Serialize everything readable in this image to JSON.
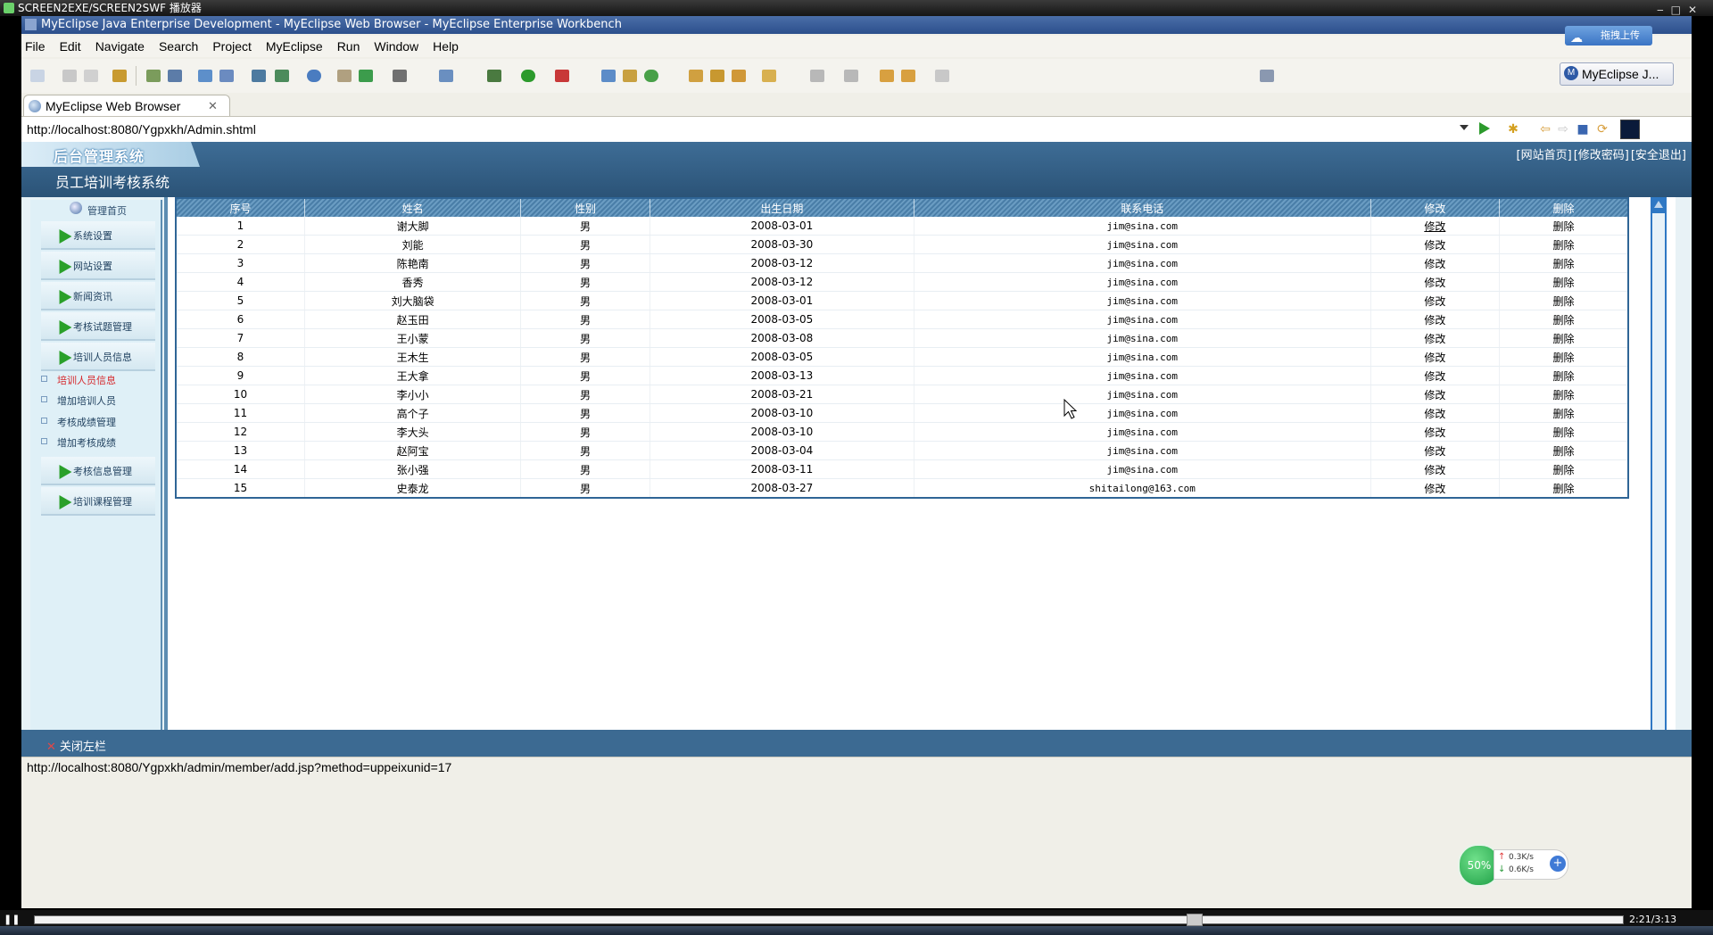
{
  "player": {
    "title": "SCREEN2EXE/SCREEN2SWF 播放器",
    "time": "2:21/3:13"
  },
  "workbench": {
    "title": "MyEclipse Java Enterprise Development - MyEclipse Web Browser - MyEclipse Enterprise Workbench",
    "menu": [
      "File",
      "Edit",
      "Navigate",
      "Search",
      "Project",
      "MyEclipse",
      "Run",
      "Window",
      "Help"
    ],
    "upload_button": "拖拽上传",
    "perspective": "MyEclipse J...",
    "tab_label": "MyEclipse Web Browser",
    "url": "http://localhost:8080/Ygpxkh/Admin.shtml",
    "status_url": "http://localhost:8080/Ygpxkh/admin/member/add.jsp?method=uppeixunid=17"
  },
  "page": {
    "logo": "后台管理系统",
    "system_title": "员工培训考核系统",
    "header_links": [
      "[网站首页]",
      "[修改密码]",
      "[安全退出]"
    ],
    "admin_home": "管理首页",
    "menu_blocks": [
      {
        "label": "系统设置"
      },
      {
        "label": "网站设置"
      },
      {
        "label": "新闻资讯"
      },
      {
        "label": "考核试题管理"
      },
      {
        "label": "培训人员信息"
      },
      {
        "label": "考核信息管理"
      },
      {
        "label": "培训课程管理"
      }
    ],
    "sub_items": [
      {
        "label": "培训人员信息",
        "active": true
      },
      {
        "label": "增加培训人员",
        "active": false
      },
      {
        "label": "考核成绩管理",
        "active": false
      },
      {
        "label": "增加考核成绩",
        "active": false
      }
    ],
    "close_left": "关闭左栏"
  },
  "table": {
    "headers": [
      "序号",
      "姓名",
      "性别",
      "出生日期",
      "联系电话",
      "修改",
      "删除"
    ],
    "rows": [
      [
        "1",
        "谢大脚",
        "男",
        "2008-03-01",
        "jim@sina.com",
        "修改",
        "删除"
      ],
      [
        "2",
        "刘能",
        "男",
        "2008-03-30",
        "jim@sina.com",
        "修改",
        "删除"
      ],
      [
        "3",
        "陈艳南",
        "男",
        "2008-03-12",
        "jim@sina.com",
        "修改",
        "删除"
      ],
      [
        "4",
        "香秀",
        "男",
        "2008-03-12",
        "jim@sina.com",
        "修改",
        "删除"
      ],
      [
        "5",
        "刘大脑袋",
        "男",
        "2008-03-01",
        "jim@sina.com",
        "修改",
        "删除"
      ],
      [
        "6",
        "赵玉田",
        "男",
        "2008-03-05",
        "jim@sina.com",
        "修改",
        "删除"
      ],
      [
        "7",
        "王小蒙",
        "男",
        "2008-03-08",
        "jim@sina.com",
        "修改",
        "删除"
      ],
      [
        "8",
        "王木生",
        "男",
        "2008-03-05",
        "jim@sina.com",
        "修改",
        "删除"
      ],
      [
        "9",
        "王大拿",
        "男",
        "2008-03-13",
        "jim@sina.com",
        "修改",
        "删除"
      ],
      [
        "10",
        "李小小",
        "男",
        "2008-03-21",
        "jim@sina.com",
        "修改",
        "删除"
      ],
      [
        "11",
        "高个子",
        "男",
        "2008-03-10",
        "jim@sina.com",
        "修改",
        "删除"
      ],
      [
        "12",
        "李大头",
        "男",
        "2008-03-10",
        "jim@sina.com",
        "修改",
        "删除"
      ],
      [
        "13",
        "赵阿宝",
        "男",
        "2008-03-04",
        "jim@sina.com",
        "修改",
        "删除"
      ],
      [
        "14",
        "张小强",
        "男",
        "2008-03-11",
        "jim@sina.com",
        "修改",
        "删除"
      ],
      [
        "15",
        "史泰龙",
        "男",
        "2008-03-27",
        "shitailong@163.com",
        "修改",
        "删除"
      ]
    ]
  },
  "netspeed": {
    "percent": "50%",
    "up": "0.3K/s",
    "down": "0.6K/s"
  }
}
